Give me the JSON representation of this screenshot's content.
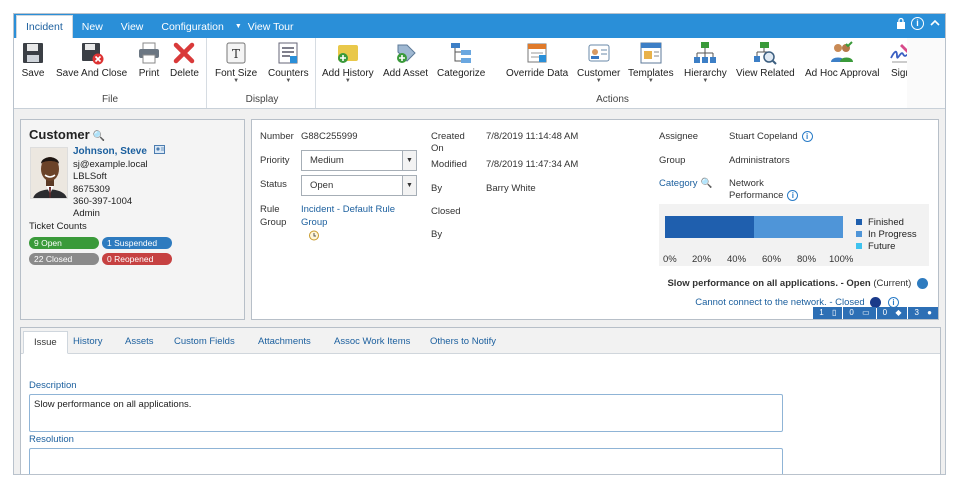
{
  "menu": {
    "tabs": [
      {
        "label": "Incident"
      },
      {
        "label": "New"
      },
      {
        "label": "View"
      },
      {
        "label": "Configuration"
      },
      {
        "label": "View Tour"
      }
    ]
  },
  "ribbon": {
    "groups": {
      "file": "File",
      "display": "Display",
      "actions": "Actions"
    },
    "buttons": {
      "save": "Save",
      "save_close": "Save And Close",
      "print": "Print",
      "delete": "Delete",
      "font_size": "Font Size",
      "counters": "Counters",
      "add_history": "Add History",
      "add_asset": "Add Asset",
      "categorize": "Categorize",
      "override_data": "Override Data",
      "customer": "Customer",
      "templates": "Templates",
      "hierarchy": "Hierarchy",
      "view_related": "View Related",
      "ad_hoc_approval": "Ad Hoc Approval",
      "sign": "Sign"
    }
  },
  "customer": {
    "title": "Customer",
    "name": "Johnson, Steve",
    "email": "sj@example.local",
    "company": "LBLSoft",
    "phone1": "8675309",
    "phone2": "360-397-1004",
    "role": "Admin",
    "ticket_counts_label": "Ticket Counts",
    "badges": {
      "open": "9 Open",
      "suspended": "1 Suspended",
      "closed": "22 Closed",
      "reopened": "0 Reopened"
    }
  },
  "ticket": {
    "number_label": "Number",
    "number": "G88C255999",
    "priority_label": "Priority",
    "priority": "Medium",
    "status_label": "Status",
    "status": "Open",
    "rule_group_label_1": "Rule",
    "rule_group_label_2": "Group",
    "rule_group_value_1": "Incident - Default Rule",
    "rule_group_value_2": "Group",
    "created_label_1": "Created",
    "created_label_2": "On",
    "created": "7/8/2019 11:14:48 AM",
    "modified_label": "Modified",
    "modified": "7/8/2019 11:47:34 AM",
    "by_label": "By",
    "modified_by": "Barry White",
    "closed_label": "Closed",
    "closed_by_label": "By",
    "assignee_label": "Assignee",
    "assignee": "Stuart Copeland",
    "group_label": "Group",
    "group": "Administrators",
    "category_label": "Category",
    "category_1": "Network",
    "category_2": "Performance",
    "current_ticket": "Slow performance on all applications. - Open",
    "current_tag": "(Current)",
    "related_ticket": "Cannot connect to the network. - Closed",
    "footer_counts": [
      "1",
      "0",
      "0",
      "3"
    ]
  },
  "chart_data": {
    "type": "bar",
    "orientation": "horizontal",
    "stacked": true,
    "categories": [
      ""
    ],
    "series": [
      {
        "name": "Finished",
        "values": [
          50
        ],
        "color": "#1f5fae"
      },
      {
        "name": "In Progress",
        "values": [
          50
        ],
        "color": "#4f95d8"
      },
      {
        "name": "Future",
        "values": [
          0
        ],
        "color": "#3fc3ef"
      }
    ],
    "x_ticks": [
      "0%",
      "20%",
      "40%",
      "60%",
      "80%",
      "100%"
    ],
    "xlim": [
      0,
      100
    ],
    "legend": "right"
  },
  "tabs": [
    {
      "label": "Issue"
    },
    {
      "label": "History"
    },
    {
      "label": "Assets"
    },
    {
      "label": "Custom Fields"
    },
    {
      "label": "Attachments"
    },
    {
      "label": "Assoc Work Items"
    },
    {
      "label": "Others to Notify"
    }
  ],
  "issue": {
    "description_label": "Description",
    "description": "Slow performance on all applications.",
    "resolution_label": "Resolution",
    "resolution": ""
  },
  "colors": {
    "menubar": "#2a8fd8",
    "link": "#1b5f9e",
    "badge_open": "#3a9a3a",
    "badge_suspended": "#2e7bbf",
    "badge_closed": "#8a8a8a",
    "badge_reopened": "#c64141"
  }
}
